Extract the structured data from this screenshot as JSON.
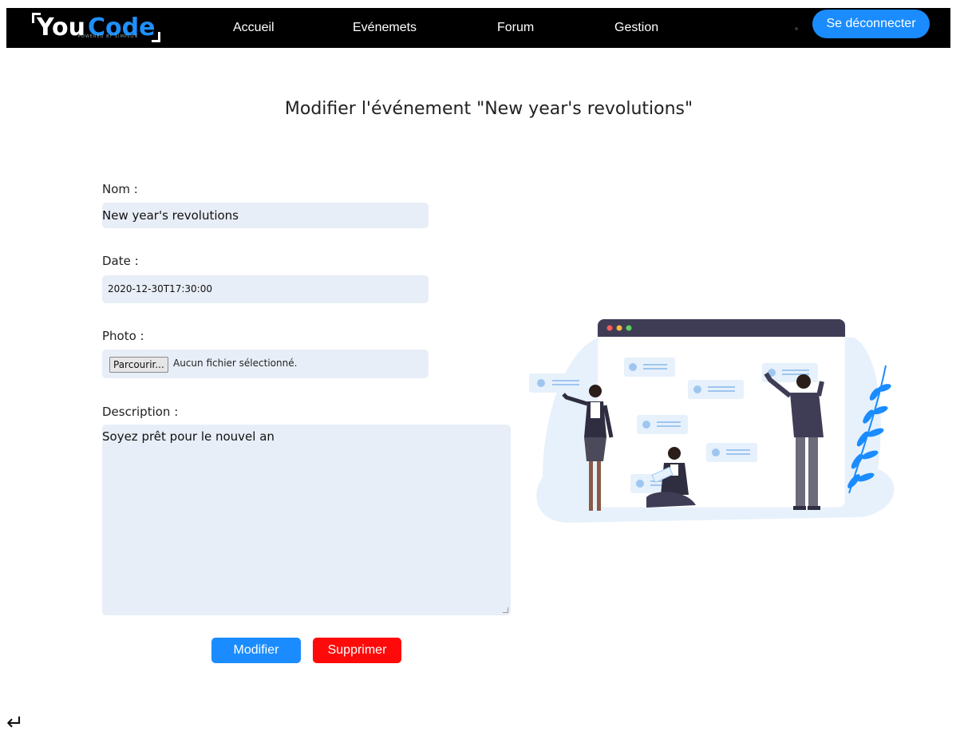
{
  "navbar": {
    "logo": {
      "you": "You",
      "code": "Code",
      "tagline": "POWERED BY SIMPLON"
    },
    "links": [
      {
        "label": "Accueil"
      },
      {
        "label": "Evénemets"
      },
      {
        "label": "Forum"
      },
      {
        "label": "Gestion"
      }
    ],
    "logout_label": "Se déconnecter"
  },
  "page": {
    "title": "Modifier l'événement \"New year's revolutions\""
  },
  "form": {
    "nom": {
      "label": "Nom :",
      "value": "New year's revolutions"
    },
    "date": {
      "label": "Date :",
      "value": "2020-12-30T17:30:00"
    },
    "photo": {
      "label": "Photo :",
      "button_label": "Parcourir...",
      "status": "Aucun fichier sélectionné."
    },
    "description": {
      "label": "Description :",
      "value": "Soyez prêt pour le nouvel an"
    },
    "modifier_label": "Modifier",
    "supprimer_label": "Supprimer"
  },
  "footer": {
    "back_icon": "↵"
  },
  "colors": {
    "navbar_bg": "#000000",
    "accent": "#1a8cff",
    "danger": "#ff0a0a",
    "field_bg": "#e8eef7"
  }
}
